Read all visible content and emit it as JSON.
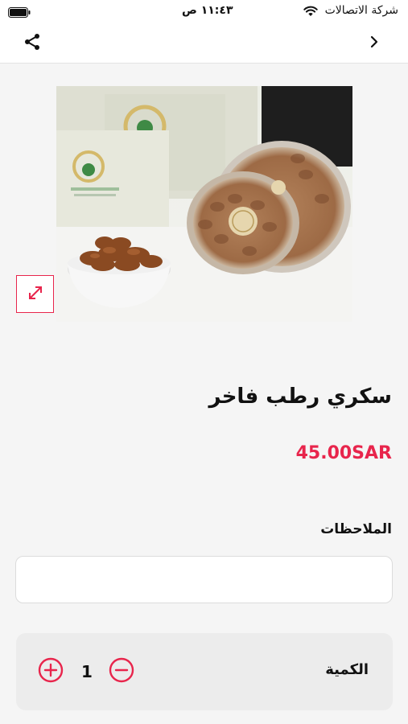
{
  "status_bar": {
    "carrier": "شركة الاتصالات",
    "time": "١١:٤٣ ص",
    "wifi_icon": "wifi-icon",
    "battery_icon": "battery-icon"
  },
  "nav_bar": {
    "share_icon": "share-icon",
    "back_icon": "chevron-right-icon"
  },
  "product": {
    "image_alt": "product-photo-dates",
    "expand_icon": "expand-icon",
    "title": "سكري رطب فاخر",
    "price": "45.00SAR"
  },
  "notes": {
    "label": "الملاحظات",
    "value": "",
    "placeholder": ""
  },
  "quantity": {
    "label": "الكمية",
    "value": "1",
    "plus_icon": "plus-circle-icon",
    "minus_icon": "minus-circle-icon"
  },
  "colors": {
    "accent": "#e8254c",
    "background": "#f5f5f5",
    "panel": "#ececec"
  }
}
